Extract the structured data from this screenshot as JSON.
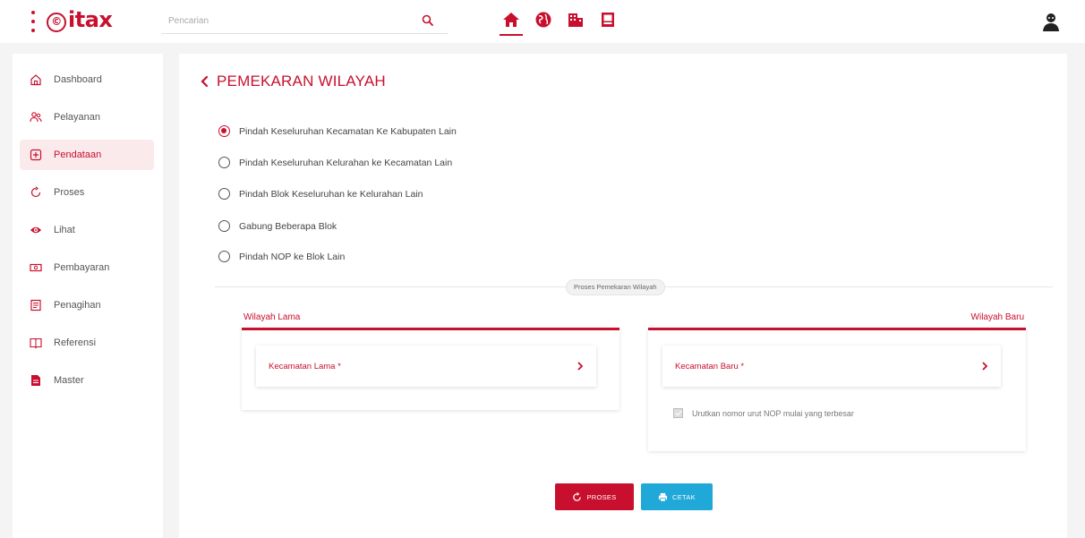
{
  "header": {
    "logo_text": "itax",
    "logo_mark": "©",
    "search": {
      "placeholder": "Pencarian",
      "value": ""
    },
    "nav_icons": [
      "home-icon",
      "globe-icon",
      "building-icon",
      "document-icon"
    ],
    "active_nav": "home-icon",
    "avatar_icon": "user-avatar-icon"
  },
  "sidebar": {
    "items": [
      {
        "label": "Dashboard",
        "icon": "home-outline-icon",
        "active": false
      },
      {
        "label": "Pelayanan",
        "icon": "users-icon",
        "active": false
      },
      {
        "label": "Pendataan",
        "icon": "plus-square-icon",
        "active": true
      },
      {
        "label": "Proses",
        "icon": "refresh-icon",
        "active": false
      },
      {
        "label": "Lihat",
        "icon": "eye-icon",
        "active": false
      },
      {
        "label": "Pembayaran",
        "icon": "money-icon",
        "active": false
      },
      {
        "label": "Penagihan",
        "icon": "invoice-icon",
        "active": false
      },
      {
        "label": "Referensi",
        "icon": "book-icon",
        "active": false
      },
      {
        "label": "Master",
        "icon": "file-icon",
        "active": false
      }
    ]
  },
  "main": {
    "title": "PEMEKARAN WILAYAH",
    "options": [
      {
        "label": "Pindah Keseluruhan Kecamatan Ke Kabupaten Lain",
        "checked": true
      },
      {
        "label": "Pindah Keseluruhan Kelurahan ke Kecamatan Lain",
        "checked": false
      },
      {
        "label": "Pindah Blok Keseluruhan ke Kelurahan Lain",
        "checked": false
      },
      {
        "label": "Gabung Beberapa Blok",
        "checked": false
      },
      {
        "label": "Pindah NOP ke Blok Lain",
        "checked": false
      }
    ],
    "section_label": "Proses Pemekaran Wilayah",
    "left_panel": {
      "label": "Wilayah Lama",
      "selector": "Kecamatan Lama *"
    },
    "right_panel": {
      "label": "Wilayah Baru",
      "selector": "Kecamatan Baru *",
      "checkbox_label": "Urutkan nomor urut NOP mulai yang terbesar",
      "checkbox_checked": true
    },
    "buttons": {
      "proses": "PROSES",
      "cetak": "CETAK"
    }
  },
  "colors": {
    "accent": "#c8102e",
    "info": "#1fa8d8"
  }
}
